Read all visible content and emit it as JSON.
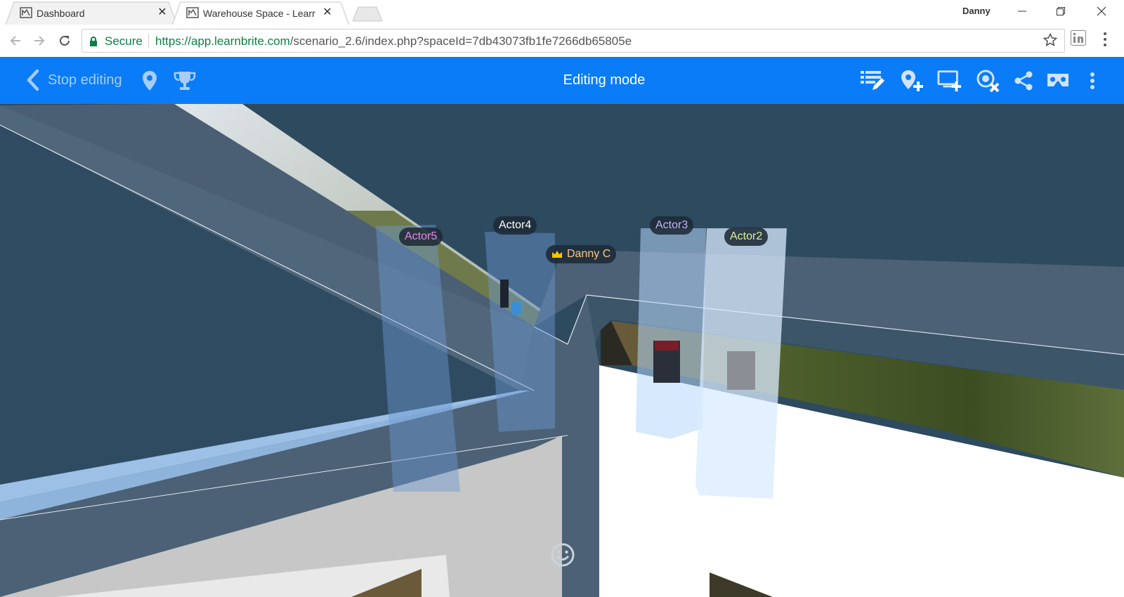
{
  "browser": {
    "tabs": [
      {
        "title": "Dashboard",
        "active": false
      },
      {
        "title": "Warehouse Space - Learr",
        "active": true
      }
    ],
    "user": "Danny",
    "omnibox": {
      "security_label": "Secure",
      "url_host": "https://app.learnbrite.com",
      "url_path": "/scenario_2.6/index.php?spaceId=7db43073fb1fe7266db65805e"
    }
  },
  "app_toolbar": {
    "stop_editing_label": "Stop editing",
    "mode_title": "Editing mode",
    "left_icons": [
      "map-pin-icon",
      "trophy-icon"
    ],
    "right_icons": [
      "edit-list-icon",
      "add-location-icon",
      "add-screen-icon",
      "remove-target-icon",
      "share-icon",
      "vr-headset-icon",
      "more-vert-icon"
    ],
    "color": "#0a7cf7"
  },
  "scene": {
    "labels": [
      {
        "text": "Actor5",
        "color": "#e58ae6"
      },
      {
        "text": "Actor4",
        "color": "#ffffff"
      },
      {
        "text": "Danny C",
        "color": "#f5c98a",
        "icon": "crown-icon"
      },
      {
        "text": "Actor3",
        "color": "#c7b6f2"
      },
      {
        "text": "Actor2",
        "color": "#d9f29a"
      }
    ],
    "emote_icon": "smiley-icon"
  }
}
